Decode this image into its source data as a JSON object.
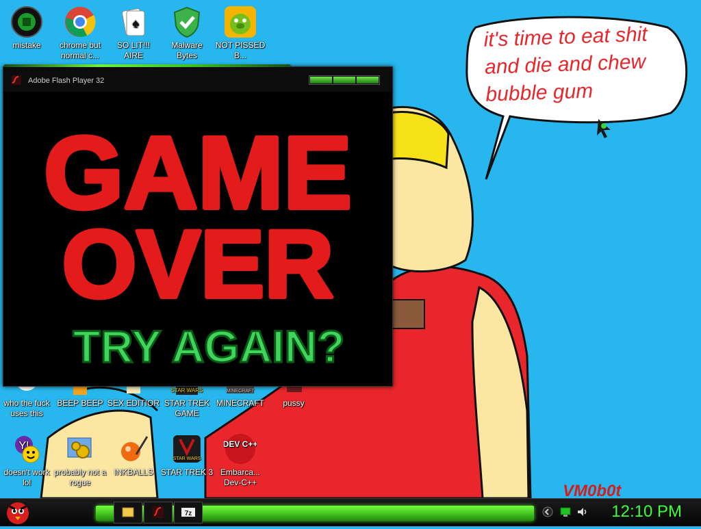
{
  "desktop": {
    "icons": [
      {
        "label": "mistake",
        "icon": "green-orb-icon"
      },
      {
        "label": "chrome but normal c...",
        "icon": "chrome-icon"
      },
      {
        "label": "SO LIT!!! AIRE",
        "icon": "solitaire-icon"
      },
      {
        "label": "Malware Bytes",
        "icon": "shield-check-icon"
      },
      {
        "label": "NOT PISSED B...",
        "icon": "green-pig-icon"
      },
      {
        "label": "who the fuck uses this",
        "icon": "ie-icon"
      },
      {
        "label": "BEEP BEEP",
        "icon": "app-icon"
      },
      {
        "label": "SEX EDITIOR",
        "icon": "app-icon"
      },
      {
        "label": "STAR TREK GAME",
        "icon": "star-wars-icon"
      },
      {
        "label": "MINECRAFT",
        "icon": "minecraft-icon"
      },
      {
        "label": "pussy",
        "icon": "app-icon"
      },
      {
        "label": "doesn't work lol",
        "icon": "yahoo-messenger-icon"
      },
      {
        "label": "probably not a rogue",
        "icon": "gears-icon"
      },
      {
        "label": "INKBALLS",
        "icon": "inkball-icon"
      },
      {
        "label": "STAR TREK 3",
        "icon": "star-wars-icon"
      },
      {
        "label": "Embarca... Dev-C++",
        "icon": "devcpp-icon"
      }
    ]
  },
  "flash_window": {
    "title": "Adobe Flash Player 32",
    "game_title_line1": "GAME",
    "game_title_line2": "OVER",
    "retry_text": "TRY AGAIN?"
  },
  "wallpaper": {
    "speech_bubble": "it's time to eat shit and die and chew bubble gum",
    "signature": "VM0b0t"
  },
  "taskbar": {
    "clock": "12:10 PM",
    "buttons": [
      "file-explorer-icon",
      "flash-player-icon",
      "7zip-icon"
    ]
  },
  "devcpp_badge": "DEV C++",
  "star_wars_badge": "STAR WARS",
  "minecraft_badge": "MINECRAFT",
  "colors": {
    "background": "#27b7ee",
    "game_red": "#e31b1b",
    "retry_green": "#3fd45a",
    "taskbar_green": "#4fe02a",
    "bubble_text": "#e8262c"
  }
}
